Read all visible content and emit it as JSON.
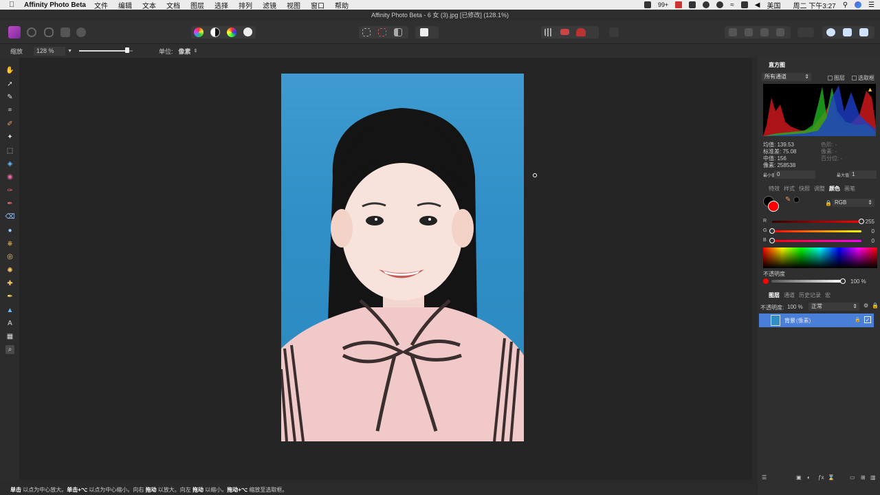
{
  "menubar": {
    "app_name": "Affinity Photo Beta",
    "items": [
      "文件",
      "编辑",
      "文本",
      "文档",
      "图层",
      "选择",
      "排列",
      "滤镜",
      "视图",
      "窗口",
      "帮助"
    ],
    "notif_count": "99+",
    "input_lang": "美国",
    "clock": "周二 下午3:27"
  },
  "window": {
    "title": "Affinity Photo Beta - 6 女 (3).jpg [已修改] (128.1%)"
  },
  "context": {
    "zoom_label": "缩放",
    "zoom_value": "128 %",
    "zoom_level": 0.9,
    "unit_label": "单位:",
    "unit_value": "像素"
  },
  "histogram": {
    "tab": "直方图",
    "channel": "所有通道",
    "layers_label": "图层",
    "marquee_label": "选取框",
    "mean": "均值: 139.53",
    "std": "标准差: 75.08",
    "median": "中值: 156",
    "pixels": "像素: 258538",
    "level": "色阶: -",
    "count": "像素: -",
    "percentile": "百分位: -",
    "min_label": "最小值",
    "min_value": "0",
    "max_label": "最大值",
    "max_value": "1"
  },
  "color_tabs": [
    "特效",
    "样式",
    "快照",
    "调整",
    "颜色",
    "画笔"
  ],
  "color": {
    "mode": "RGB",
    "r_label": "R",
    "r": "255",
    "r_level": 1.0,
    "g_label": "G",
    "g": "0",
    "g_level": 0.0,
    "b_label": "B",
    "b": "0",
    "b_level": 0.0,
    "opacity_label": "不透明度",
    "opacity": "100 %",
    "opacity_level": 1.0,
    "fill": "#ff0000"
  },
  "layer_tabs": [
    "图层",
    "通道",
    "历史记录",
    "宏"
  ],
  "layers": {
    "opacity_label": "不透明度:",
    "opacity": "100 %",
    "blend": "正常",
    "items": [
      {
        "name": "背景",
        "type": "(像素)"
      }
    ]
  },
  "status": {
    "parts": [
      "单击",
      " 以点为中心放大。",
      "单击+⌥",
      " 以点为中心缩小。向右 ",
      "拖动",
      " 以放大。向左 ",
      "拖动",
      " 以缩小。",
      "拖动+⌥",
      " 缩放至选取框。"
    ]
  }
}
